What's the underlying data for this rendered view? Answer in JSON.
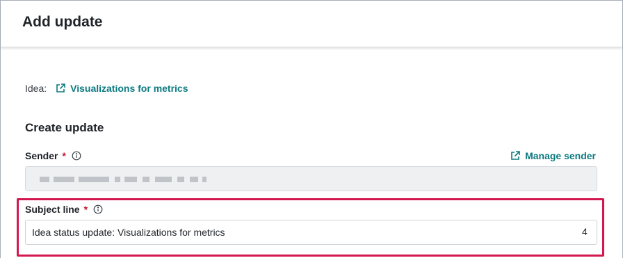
{
  "header": {
    "title": "Add update"
  },
  "idea": {
    "label": "Idea:",
    "link_text": "Visualizations for metrics",
    "link_icon": "external-link-icon"
  },
  "section": {
    "title": "Create update"
  },
  "sender": {
    "label": "Sender",
    "required_mark": "*",
    "info_icon": "info-icon",
    "manage_label": "Manage sender",
    "value_redacted": true
  },
  "subject": {
    "label": "Subject line",
    "required_mark": "*",
    "info_icon": "info-icon",
    "value": "Idea status update: Visualizations for metrics",
    "count": "4"
  },
  "colors": {
    "link": "#0c7a80",
    "required": "#c8102e",
    "highlight": "#d3174f",
    "disabled_field": "#eef0f2"
  }
}
